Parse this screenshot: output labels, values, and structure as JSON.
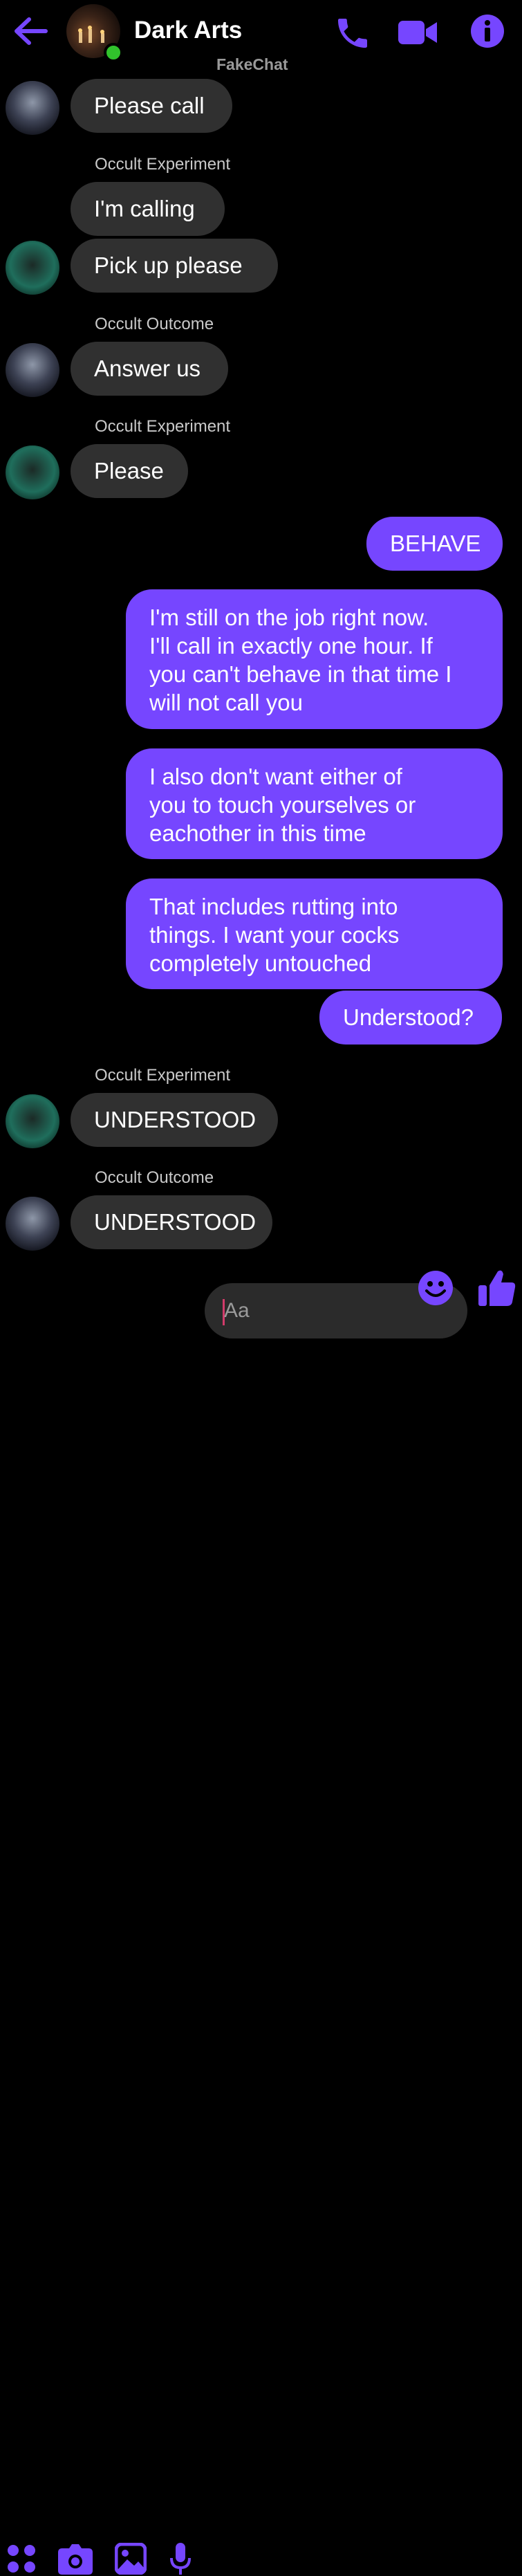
{
  "header": {
    "title": "Dark Arts",
    "subtitle": "FakeChat",
    "icons": [
      "back-arrow-icon",
      "phone-icon",
      "video-camera-icon",
      "info-icon"
    ]
  },
  "colors": {
    "accent": "#7646ff",
    "incoming_bubble": "#303030",
    "online": "#31c22c"
  },
  "messages": [
    {
      "text": "Please call"
    },
    {
      "sender": "Occult Experiment",
      "text": "I'm calling"
    },
    {
      "text": "Pick up please"
    },
    {
      "sender": "Occult Outcome",
      "text": "Answer us"
    },
    {
      "sender": "Occult Experiment",
      "text": "Please"
    },
    {
      "text": "BEHAVE"
    },
    {
      "lines": [
        "I'm still on the job right now.",
        "I'll call in exactly one hour.  If",
        "you can't behave in that time I",
        "will not call you"
      ]
    },
    {
      "lines": [
        "I also don't want either of",
        "you to touch yourselves or",
        "eachother in this time"
      ]
    },
    {
      "lines": [
        "That includes rutting into",
        "things.  I want your cocks",
        "completely untouched"
      ]
    },
    {
      "text": "Understood?"
    },
    {
      "sender": "Occult Experiment",
      "text": "UNDERSTOOD"
    },
    {
      "sender": "Occult Outcome",
      "text": "UNDERSTOOD"
    }
  ],
  "composer": {
    "placeholder": "Aa",
    "icons": [
      "apps-icon",
      "camera-icon",
      "image-icon",
      "microphone-icon",
      "emoji-icon",
      "thumbs-up-icon"
    ]
  }
}
